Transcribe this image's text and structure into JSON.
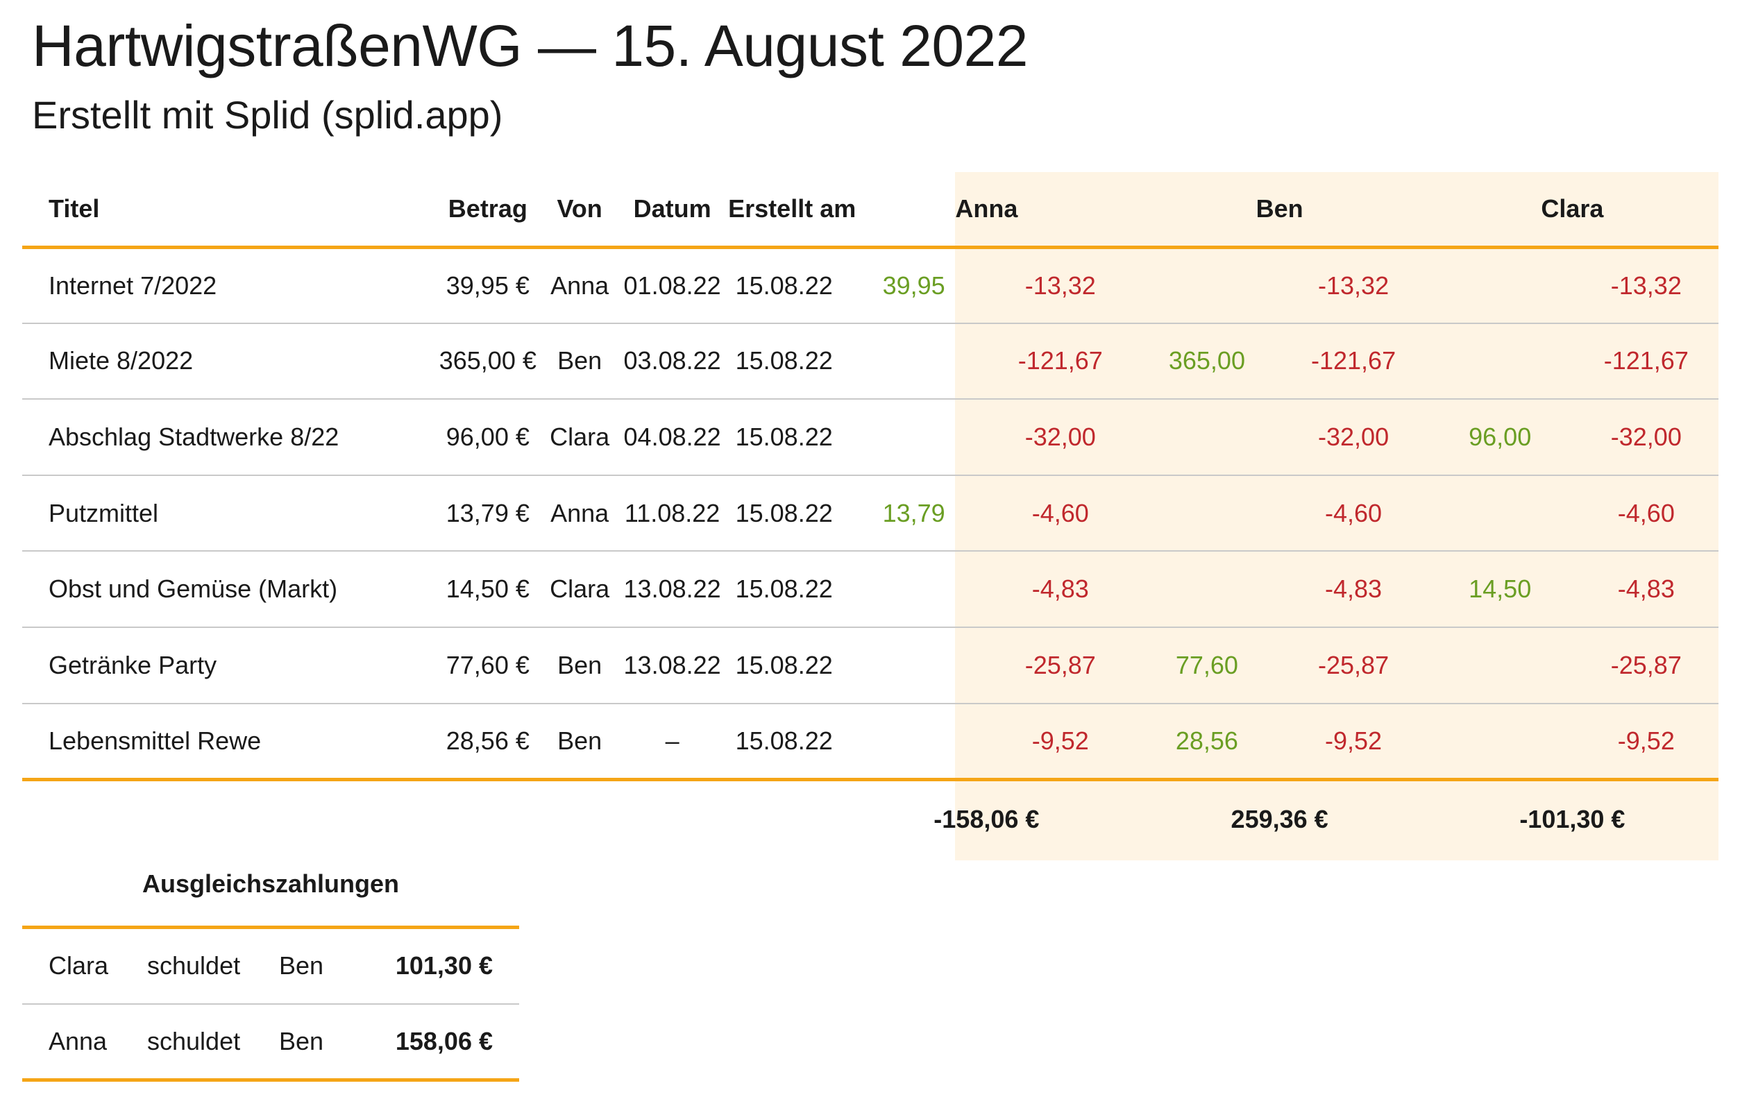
{
  "header": {
    "title": "HartwigstraßenWG — 15. August 2022",
    "subtitle": "Erstellt mit Splid (splid.app)"
  },
  "columns": {
    "titel": "Titel",
    "betrag": "Betrag",
    "von": "Von",
    "datum": "Datum",
    "erstellt": "Erstellt am"
  },
  "participants": [
    "Anna",
    "Ben",
    "Clara"
  ],
  "expenses": [
    {
      "title": "Internet 7/2022",
      "amount": "39,95 €",
      "from": "Anna",
      "date": "01.08.22",
      "created": "15.08.22",
      "cells": [
        [
          "39,95",
          "-13,32"
        ],
        [
          "",
          "-13,32"
        ],
        [
          "",
          "-13,32"
        ]
      ]
    },
    {
      "title": "Miete 8/2022",
      "amount": "365,00 €",
      "from": "Ben",
      "date": "03.08.22",
      "created": "15.08.22",
      "cells": [
        [
          "",
          "-121,67"
        ],
        [
          "365,00",
          "-121,67"
        ],
        [
          "",
          "-121,67"
        ]
      ]
    },
    {
      "title": "Abschlag Stadtwerke 8/22",
      "amount": "96,00 €",
      "from": "Clara",
      "date": "04.08.22",
      "created": "15.08.22",
      "cells": [
        [
          "",
          "-32,00"
        ],
        [
          "",
          "-32,00"
        ],
        [
          "96,00",
          "-32,00"
        ]
      ]
    },
    {
      "title": "Putzmittel",
      "amount": "13,79 €",
      "from": "Anna",
      "date": "11.08.22",
      "created": "15.08.22",
      "cells": [
        [
          "13,79",
          "-4,60"
        ],
        [
          "",
          "-4,60"
        ],
        [
          "",
          "-4,60"
        ]
      ]
    },
    {
      "title": "Obst und Gemüse (Markt)",
      "amount": "14,50 €",
      "from": "Clara",
      "date": "13.08.22",
      "created": "15.08.22",
      "cells": [
        [
          "",
          "-4,83"
        ],
        [
          "",
          "-4,83"
        ],
        [
          "14,50",
          "-4,83"
        ]
      ]
    },
    {
      "title": "Getränke Party",
      "amount": "77,60 €",
      "from": "Ben",
      "date": "13.08.22",
      "created": "15.08.22",
      "cells": [
        [
          "",
          "-25,87"
        ],
        [
          "77,60",
          "-25,87"
        ],
        [
          "",
          "-25,87"
        ]
      ]
    },
    {
      "title": "Lebensmittel Rewe",
      "amount": "28,56 €",
      "from": "Ben",
      "date": "–",
      "created": "15.08.22",
      "cells": [
        [
          "",
          "-9,52"
        ],
        [
          "28,56",
          "-9,52"
        ],
        [
          "",
          "-9,52"
        ]
      ]
    }
  ],
  "totals": [
    "-158,06 €",
    "259,36 €",
    "-101,30 €"
  ],
  "settlements": {
    "title": "Ausgleichszahlungen",
    "rows": [
      {
        "from": "Clara",
        "verb": "schuldet",
        "to": "Ben",
        "amount": "101,30 €"
      },
      {
        "from": "Anna",
        "verb": "schuldet",
        "to": "Ben",
        "amount": "158,06 €"
      }
    ]
  },
  "colors": {
    "accent": "#f5a516",
    "paid": "#6a9e23",
    "share": "#c0282d",
    "participant_bg": "#fef4e4"
  }
}
